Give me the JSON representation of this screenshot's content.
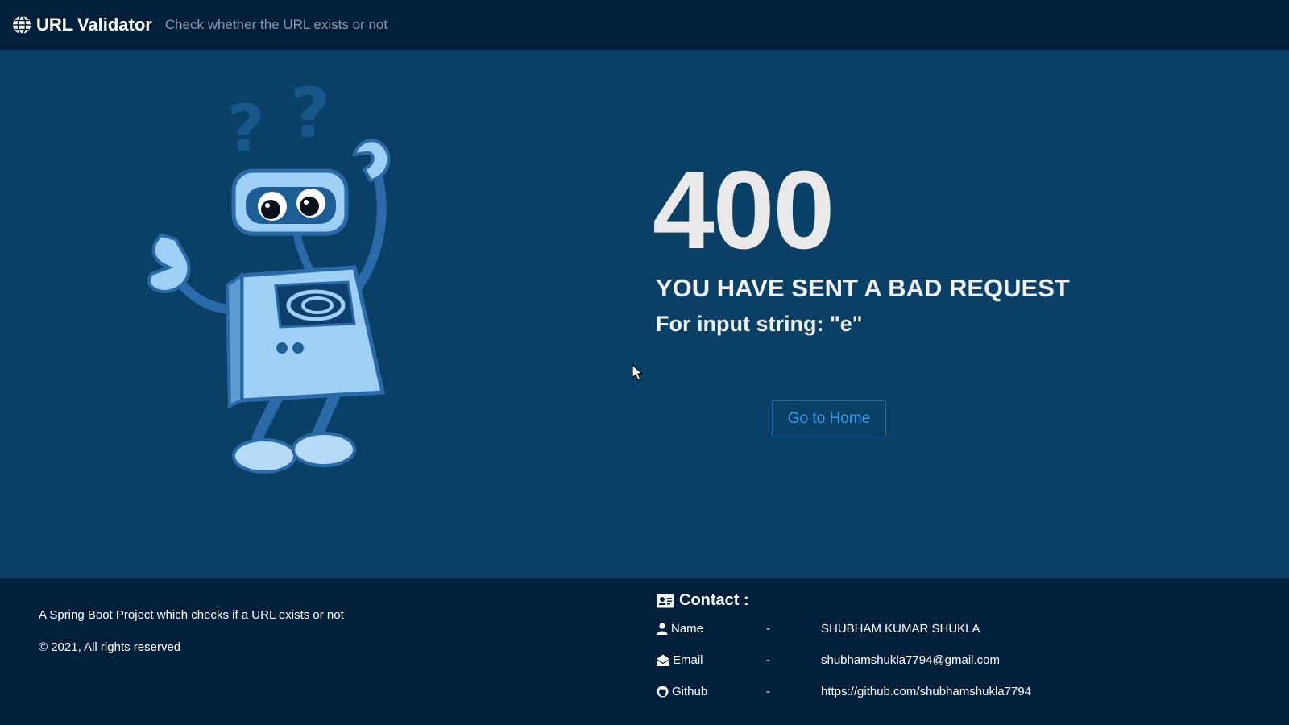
{
  "navbar": {
    "brand": "URL Validator",
    "brand_icon": "globe-icon",
    "tagline": "Check whether the URL exists or not"
  },
  "error": {
    "code": "400",
    "title": "YOU HAVE SENT A BAD REQUEST",
    "detail": "For input string: \"e\"",
    "home_button": "Go to Home"
  },
  "footer": {
    "description": "A Spring Boot Project which checks if a URL exists or not",
    "copyright": "© 2021, All rights reserved",
    "contact": {
      "heading": "Contact :",
      "rows": [
        {
          "icon": "user-icon",
          "label": "Name",
          "sep": "-",
          "value": "SHUBHAM KUMAR SHUKLA"
        },
        {
          "icon": "envelope-icon",
          "label": "Email",
          "sep": "-",
          "value": "shubhamshukla7794@gmail.com"
        },
        {
          "icon": "github-icon",
          "label": "Github",
          "sep": "-",
          "value": "https://github.com/shubhamshukla7794"
        }
      ]
    }
  },
  "colors": {
    "navbar_bg": "#02203c",
    "main_bg": "#0b4066",
    "accent": "#3a9cf0",
    "robot_light": "#9ecff5",
    "robot_dark": "#2a6aa8"
  }
}
